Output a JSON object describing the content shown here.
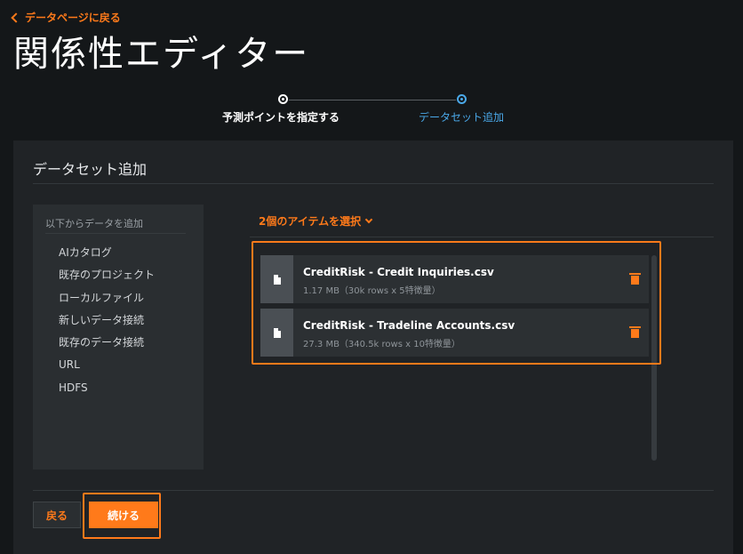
{
  "nav": {
    "back_link": "データページに戻る"
  },
  "page": {
    "title": "関係性エディター"
  },
  "stepper": {
    "steps": [
      {
        "label": "予測ポイントを指定する",
        "state": "completed"
      },
      {
        "label": "データセット追加",
        "state": "active"
      }
    ]
  },
  "panel": {
    "title": "データセット追加",
    "sources": {
      "header": "以下からデータを追加",
      "items": [
        "AIカタログ",
        "既存のプロジェクト",
        "ローカルファイル",
        "新しいデータ接続",
        "既存のデータ接続",
        "URL",
        "HDFS"
      ]
    },
    "selection": {
      "toggle_label": "2個のアイテムを選択",
      "files": [
        {
          "name": "CreditRisk - Credit Inquiries.csv",
          "meta": "1.17 MB（30k rows x 5特徴量）",
          "icon": "file-icon",
          "action_icon": "trash-icon"
        },
        {
          "name": "CreditRisk - Tradeline Accounts.csv",
          "meta": "27.3 MB（340.5k rows x 10特徴量）",
          "icon": "file-icon",
          "action_icon": "trash-icon"
        }
      ]
    },
    "buttons": {
      "back": "戻る",
      "continue": "続ける"
    }
  },
  "colors": {
    "accent": "#ff7a1a",
    "active_step": "#4aa8e8",
    "background": "#141719",
    "panel": "#202326"
  }
}
